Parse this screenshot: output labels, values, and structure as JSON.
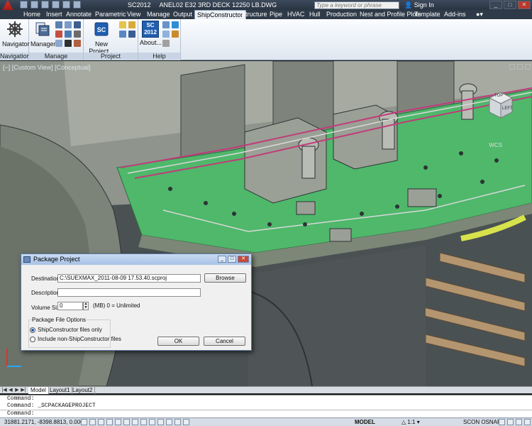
{
  "window": {
    "app_title": "SC2012",
    "doc_title": "ANEL02 E32 3RD DECK 12250 LB.DWG",
    "search_placeholder": "Type a keyword or phrase",
    "sign_in": "Sign In"
  },
  "ribbon_tabs": [
    "Home",
    "Insert",
    "Annotate",
    "Parametric",
    "View",
    "Manage",
    "Output",
    "ShipConstructor",
    "Structure",
    "Pipe",
    "HVAC",
    "Hull",
    "Production",
    "Nest and Profile Plots",
    "Template",
    "Add-ins"
  ],
  "active_tab": "ShipConstructor",
  "ribbon": {
    "navigation": {
      "navigator_label": "Navigator",
      "group_label": "Navigation"
    },
    "manage": {
      "manager_label": "Manager",
      "group_label": "Manage"
    },
    "project": {
      "new_project_label": "New Project...",
      "group_label": "Project"
    },
    "help": {
      "about_label": "About...",
      "group_label": "Help",
      "badge_line1": "SC",
      "badge_line2": "2012"
    }
  },
  "viewport": {
    "view_label": "[−] [Custom View] [Conceptual]",
    "viewcube_top": "TOP",
    "viewcube_front": "LEFT",
    "wcs_label": "WCS"
  },
  "dialog": {
    "title": "Package Project",
    "destination_label": "Destination",
    "destination_value": "C:\\SUEXMAX_2011-08-09 17.53.40.scproj",
    "browse_label": "Browse",
    "description_label": "Description",
    "description_value": "",
    "volume_size_label": "Volume Size",
    "volume_size_value": "0",
    "volume_size_hint": "(MB) 0 = Unlimited",
    "options_group_label": "Package File Options",
    "option_sc_only": "ShipConstructor files only",
    "option_include_non_sc": "Include non-ShipConstructor files",
    "selected_option": "sc_only",
    "ok_label": "OK",
    "cancel_label": "Cancel"
  },
  "layout_tabs": [
    "Model",
    "Layout1",
    "Layout2"
  ],
  "command": {
    "line1": "Command:",
    "line2": "Command:  _SCPACKAGEPROJECT",
    "line3": "Command:"
  },
  "status": {
    "coords": "31881.2171, -8398.8813, 0.0000",
    "model": "MODEL",
    "scale": "1:1",
    "scon_osnap": "SCON OSNAP"
  },
  "colors": {
    "accent": "#4d6b96",
    "deck_green": "#4fb86b",
    "hull_gray": "#8c9188"
  }
}
